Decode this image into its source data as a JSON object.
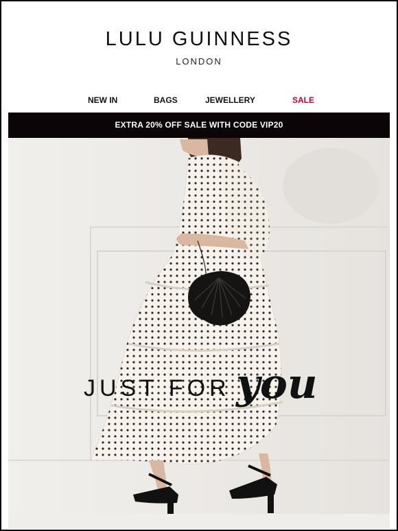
{
  "brand": {
    "name": "LULU GUINNESS",
    "city": "LONDON"
  },
  "nav": {
    "items": [
      {
        "label": "NEW IN"
      },
      {
        "label": "BAGS"
      },
      {
        "label": "JEWELLERY"
      },
      {
        "label": "SALE"
      }
    ]
  },
  "colors": {
    "promo_background": "#0b0507",
    "sale_link": "#c0003b",
    "text": "#111111"
  },
  "promo": {
    "text": "EXTRA 20% OFF SALE WITH CODE VIP20"
  },
  "hero": {
    "headline_plain": "JUST FOR",
    "headline_script": "you"
  }
}
